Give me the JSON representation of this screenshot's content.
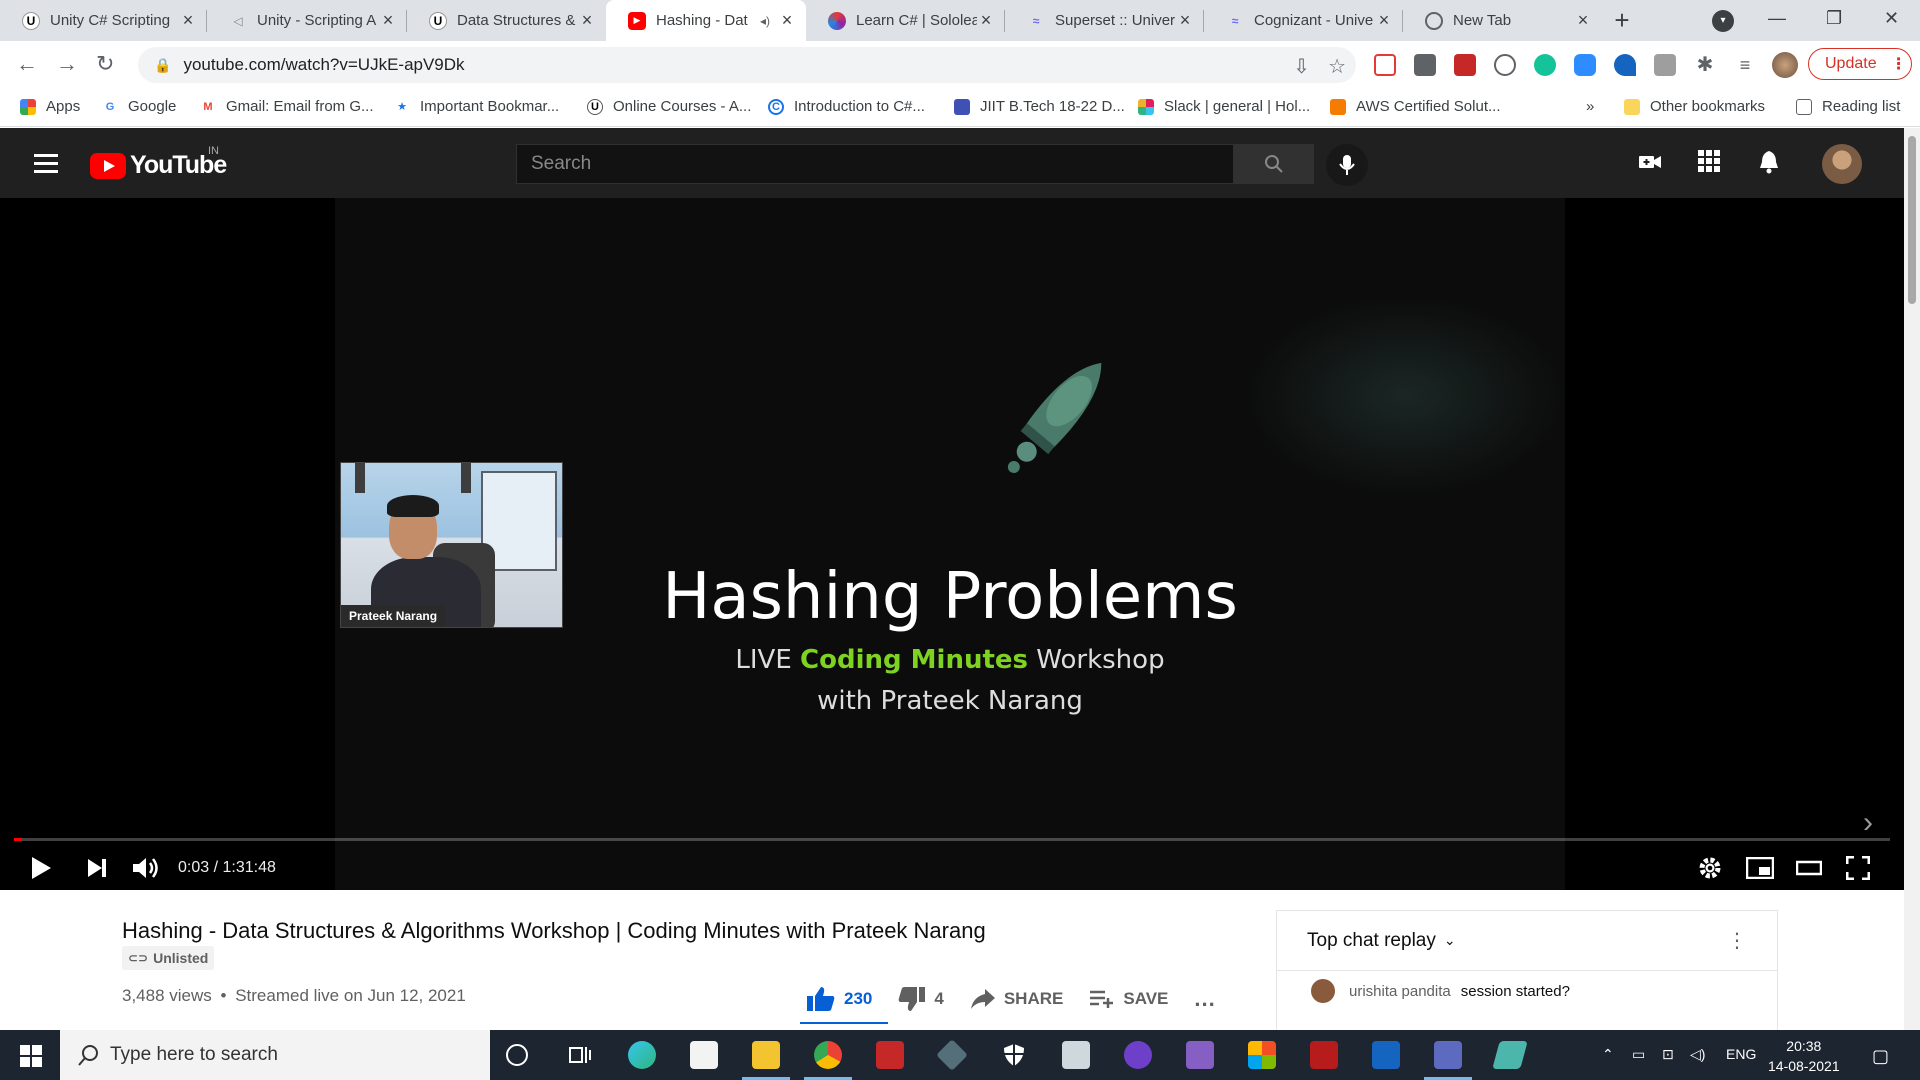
{
  "tabs": [
    {
      "title": "Unity C# Scripting",
      "active": false
    },
    {
      "title": "Unity - Scripting A",
      "active": false
    },
    {
      "title": "Data Structures &",
      "active": false
    },
    {
      "title": "Hashing - Dat",
      "active": true
    },
    {
      "title": "Learn C# | Sololea",
      "active": false
    },
    {
      "title": "Superset :: Univer",
      "active": false
    },
    {
      "title": "Cognizant - Unive",
      "active": false
    },
    {
      "title": "New Tab",
      "active": false
    }
  ],
  "address_bar": {
    "url": "youtube.com/watch?v=UJkE-apV9Dk"
  },
  "update_button": "Update",
  "bookmarks": [
    "Apps",
    "Google",
    "Gmail: Email from G...",
    "Important Bookmar...",
    "Online Courses - A...",
    "Introduction to C#...",
    "JIIT B.Tech 18-22 D...",
    "Slack | general | Hol...",
    "AWS Certified Solut..."
  ],
  "bookmarks_overflow": "»",
  "other_bookmarks": "Other bookmarks",
  "reading_list": "Reading list",
  "youtube": {
    "logo_text": "YouTube",
    "country_code": "IN",
    "search_placeholder": "Search"
  },
  "player": {
    "slide_title": "Hashing Problems",
    "slide_sub_pre": "LIVE ",
    "slide_sub_highlight": "Coding Minutes",
    "slide_sub_post": " Workshop",
    "slide_sub2": "with Prateek Narang",
    "webcam_name": "Prateek Narang",
    "timecode": "0:03 / 1:31:48",
    "progress_fraction": 0.0005
  },
  "video": {
    "title": "Hashing - Data Structures & Algorithms Workshop | Coding Minutes with Prateek Narang",
    "unlisted_label": "Unlisted",
    "views": "3,488 views",
    "separator": "•",
    "streamed": "Streamed live on Jun 12, 2021",
    "likes": "230",
    "dislikes": "4",
    "share_label": "SHARE",
    "save_label": "SAVE",
    "more_label": "..."
  },
  "chat": {
    "header": "Top chat replay",
    "messages": [
      {
        "author": "urishita pandita",
        "text": "session started?"
      }
    ]
  },
  "taskbar": {
    "search_placeholder": "Type here to search",
    "language": "ENG",
    "time": "20:38",
    "date": "14-08-2021"
  },
  "colors": {
    "youtube_red": "#ff0000",
    "accent_blue": "#065fd4",
    "update_red": "#d93025",
    "highlight_green": "#7ed321"
  }
}
